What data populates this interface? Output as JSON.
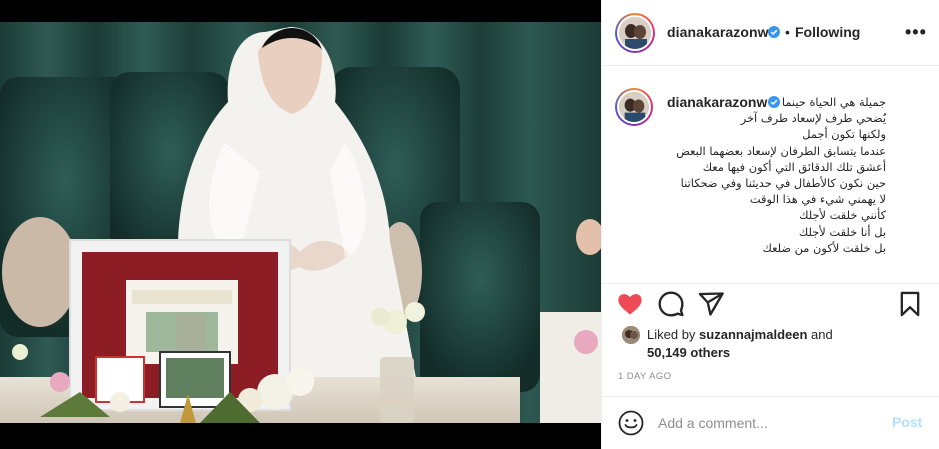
{
  "post": {
    "username": "dianakarazonw",
    "verified": true,
    "separator": "•",
    "follow_status": "Following",
    "more_label": "•••",
    "caption": {
      "username": "dianakarazonw",
      "lines": [
        "جميلة هي الحياة حينما",
        "يُضحي طرف لإسعاد طرف آخر",
        "ولكنها تكون أجمل",
        "عندما يتسابق الطرفان لإسعاد بعضهما البعض",
        "أعشق تلك الدقائق التي أكون فيها معك",
        "حين نكون كالأطفال في حديثنا وفي ضحكاتنا",
        "لا يهمني شيء في هذا الوقت",
        "كأنني خلقت لأجلك",
        "بل أنا خلقت لأجلك",
        "بل خلقت لأكون من ضلعك"
      ]
    },
    "actions": {
      "like_icon": "heart-filled-icon",
      "comment_icon": "comment-icon",
      "share_icon": "paper-plane-icon",
      "save_icon": "bookmark-icon"
    },
    "likes": {
      "prefix": "Liked by ",
      "user": "suzannajmaldeen",
      "middle": " and",
      "count_text": "50,149 others"
    },
    "timestamp": "1 DAY AGO",
    "comment_box": {
      "placeholder": "Add a comment...",
      "post_label": "Post",
      "emoji_icon": "smiley-icon"
    }
  },
  "colors": {
    "like_red": "#ed4956",
    "verified_blue": "#3897f0",
    "post_disabled": "#b2dffc",
    "muted_text": "#8e8e8e"
  }
}
